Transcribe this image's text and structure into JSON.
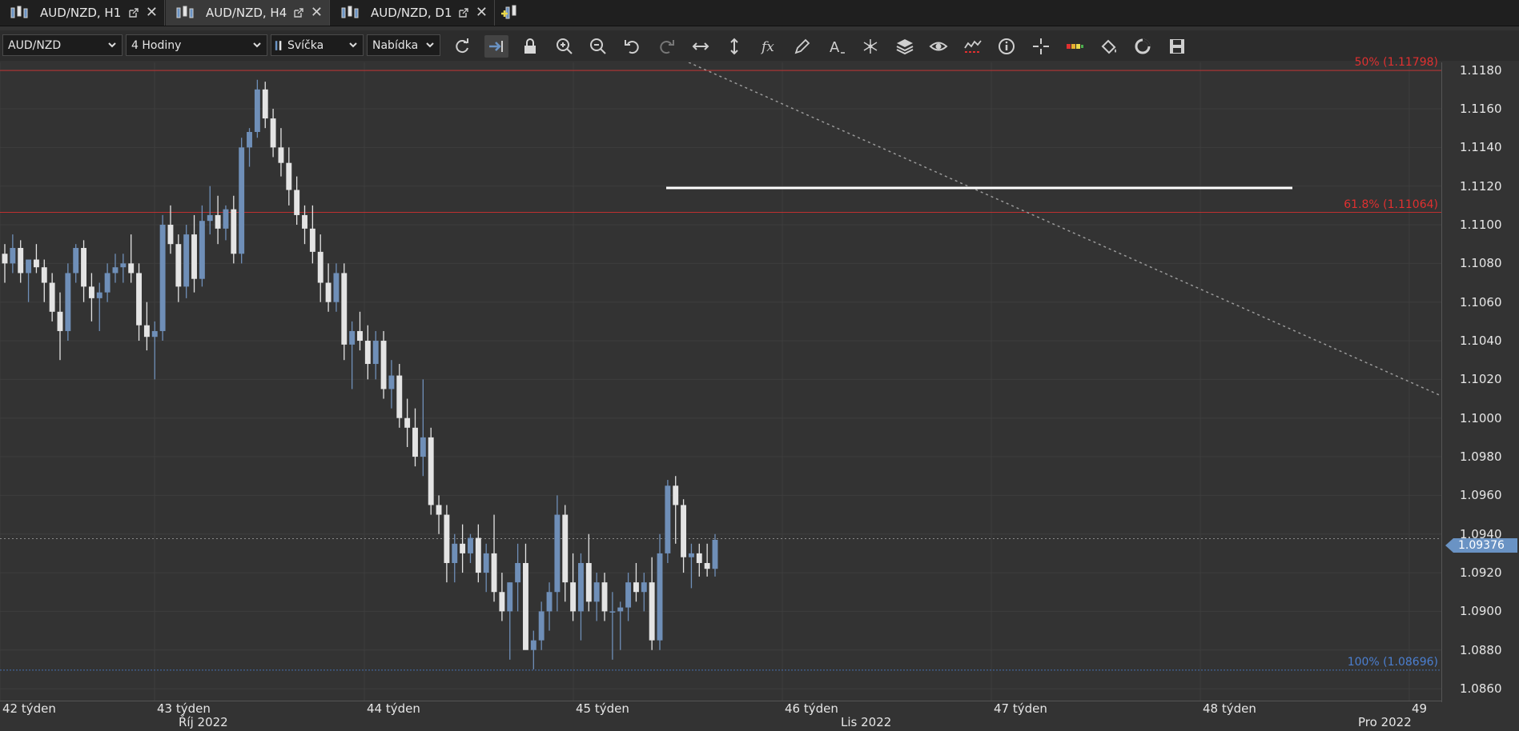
{
  "tabs": [
    {
      "label": "AUD/NZD, H1",
      "active": false
    },
    {
      "label": "AUD/NZD, H4",
      "active": true
    },
    {
      "label": "AUD/NZD, D1",
      "active": false
    }
  ],
  "toolbar": {
    "symbol": "AUD/NZD",
    "timeframe": "4 Hodiny",
    "chart_type": "Svíčka",
    "price_side": "Nabídka",
    "buttons": [
      "refresh-icon",
      "autoscroll-icon",
      "lock-icon",
      "zoom-in-icon",
      "zoom-out-icon",
      "undo-icon",
      "redo-icon",
      "horizontal-resize-icon",
      "vertical-resize-icon",
      "function-icon",
      "pencil-icon",
      "text-icon",
      "pattern-icon",
      "layers-icon",
      "eye-icon",
      "indicator-icon",
      "info-icon",
      "crosshair-icon",
      "heatmap-icon",
      "paint-bucket-icon",
      "template-icon",
      "save-icon"
    ]
  },
  "chart_data": {
    "type": "candlestick",
    "symbol": "AUD/NZD",
    "timeframe": "H4",
    "y_axis_ticks": [
      "1.1180",
      "1.1160",
      "1.1140",
      "1.1120",
      "1.1100",
      "1.1080",
      "1.1060",
      "1.1040",
      "1.1020",
      "1.1000",
      "1.0980",
      "1.0960",
      "1.0940",
      "1.0920",
      "1.0900",
      "1.0880",
      "1.0860"
    ],
    "ylim": [
      1.0853,
      1.1184
    ],
    "current_price": "1.09376",
    "week_labels": [
      "42 týden",
      "43 týden",
      "44 týden",
      "45 týden",
      "46 týden",
      "47 týden",
      "48 týden",
      "49"
    ],
    "month_labels": [
      "Říj 2022",
      "Lis 2022",
      "Pro 2022"
    ],
    "fib_levels": [
      {
        "label": "50% (1.11798)",
        "price": 1.11798,
        "color": "#e03030"
      },
      {
        "label": "61.8% (1.11064)",
        "price": 1.11064,
        "color": "#e03030"
      },
      {
        "label": "100% (1.08696)",
        "price": 1.08696,
        "color": "#4b7fd1"
      }
    ],
    "candles": [
      [
        1.1085,
        1.109,
        1.107,
        1.108
      ],
      [
        1.108,
        1.1095,
        1.1075,
        1.1088
      ],
      [
        1.1088,
        1.1092,
        1.107,
        1.1075
      ],
      [
        1.1075,
        1.108,
        1.106,
        1.1082
      ],
      [
        1.1082,
        1.109,
        1.1075,
        1.1078
      ],
      [
        1.1078,
        1.1082,
        1.106,
        1.107
      ],
      [
        1.107,
        1.1075,
        1.105,
        1.1055
      ],
      [
        1.1055,
        1.1065,
        1.103,
        1.1045
      ],
      [
        1.1045,
        1.108,
        1.104,
        1.1075
      ],
      [
        1.1075,
        1.109,
        1.107,
        1.1088
      ],
      [
        1.1088,
        1.1092,
        1.106,
        1.1068
      ],
      [
        1.1068,
        1.1075,
        1.105,
        1.1062
      ],
      [
        1.1062,
        1.107,
        1.1045,
        1.1065
      ],
      [
        1.1065,
        1.108,
        1.106,
        1.1075
      ],
      [
        1.1075,
        1.1085,
        1.107,
        1.1078
      ],
      [
        1.1078,
        1.1085,
        1.107,
        1.108
      ],
      [
        1.108,
        1.1095,
        1.107,
        1.1075
      ],
      [
        1.1075,
        1.108,
        1.104,
        1.1048
      ],
      [
        1.1048,
        1.106,
        1.1035,
        1.1042
      ],
      [
        1.1042,
        1.105,
        1.102,
        1.1045
      ],
      [
        1.1045,
        1.1105,
        1.104,
        1.11
      ],
      [
        1.11,
        1.111,
        1.1085,
        1.109
      ],
      [
        1.109,
        1.1095,
        1.106,
        1.1068
      ],
      [
        1.1068,
        1.11,
        1.1062,
        1.1095
      ],
      [
        1.1095,
        1.1105,
        1.1065,
        1.1072
      ],
      [
        1.1072,
        1.111,
        1.1068,
        1.1102
      ],
      [
        1.1102,
        1.112,
        1.1095,
        1.1105
      ],
      [
        1.1105,
        1.1115,
        1.109,
        1.1098
      ],
      [
        1.1098,
        1.111,
        1.1092,
        1.1108
      ],
      [
        1.1108,
        1.1115,
        1.108,
        1.1085
      ],
      [
        1.1085,
        1.1145,
        1.108,
        1.114
      ],
      [
        1.114,
        1.115,
        1.113,
        1.1148
      ],
      [
        1.1148,
        1.1175,
        1.1145,
        1.117
      ],
      [
        1.117,
        1.1174,
        1.115,
        1.1155
      ],
      [
        1.1155,
        1.116,
        1.1135,
        1.114
      ],
      [
        1.114,
        1.115,
        1.1125,
        1.1132
      ],
      [
        1.1132,
        1.114,
        1.111,
        1.1118
      ],
      [
        1.1118,
        1.1125,
        1.11,
        1.1105
      ],
      [
        1.1105,
        1.111,
        1.109,
        1.1098
      ],
      [
        1.1098,
        1.111,
        1.108,
        1.1086
      ],
      [
        1.1086,
        1.1095,
        1.106,
        1.107
      ],
      [
        1.107,
        1.108,
        1.1055,
        1.106
      ],
      [
        1.106,
        1.108,
        1.1055,
        1.1075
      ],
      [
        1.1075,
        1.108,
        1.103,
        1.1038
      ],
      [
        1.1038,
        1.105,
        1.1015,
        1.1045
      ],
      [
        1.1045,
        1.1055,
        1.1035,
        1.104
      ],
      [
        1.104,
        1.1048,
        1.102,
        1.1028
      ],
      [
        1.1028,
        1.1045,
        1.102,
        1.104
      ],
      [
        1.104,
        1.1045,
        1.101,
        1.1015
      ],
      [
        1.1015,
        1.103,
        1.1005,
        1.1022
      ],
      [
        1.1022,
        1.1028,
        1.0995,
        1.1
      ],
      [
        1.1,
        1.101,
        1.0985,
        1.0995
      ],
      [
        1.0995,
        1.1005,
        1.0975,
        1.098
      ],
      [
        1.098,
        1.102,
        1.097,
        1.099
      ],
      [
        1.099,
        1.0995,
        1.095,
        1.0955
      ],
      [
        1.0955,
        1.096,
        1.094,
        1.095
      ],
      [
        1.095,
        1.0955,
        1.0915,
        1.0925
      ],
      [
        1.0925,
        1.094,
        1.0915,
        1.0935
      ],
      [
        1.0935,
        1.0945,
        1.092,
        1.093
      ],
      [
        1.093,
        1.094,
        1.0925,
        1.0938
      ],
      [
        1.0938,
        1.0945,
        1.0915,
        1.092
      ],
      [
        1.092,
        1.0935,
        1.091,
        1.093
      ],
      [
        1.093,
        1.095,
        1.0905,
        1.091
      ],
      [
        1.091,
        1.092,
        1.0895,
        1.09
      ],
      [
        1.09,
        1.0915,
        1.0875,
        1.0915
      ],
      [
        1.0915,
        1.0935,
        1.09,
        1.0925
      ],
      [
        1.0925,
        1.0935,
        1.0895,
        1.088
      ],
      [
        1.088,
        1.089,
        1.087,
        1.0885
      ],
      [
        1.0885,
        1.0905,
        1.088,
        1.09
      ],
      [
        1.09,
        1.0915,
        1.089,
        1.091
      ],
      [
        1.091,
        1.096,
        1.09,
        1.095
      ],
      [
        1.095,
        1.0955,
        1.0905,
        1.0915
      ],
      [
        1.0915,
        1.093,
        1.0895,
        1.09
      ],
      [
        1.09,
        1.093,
        1.0885,
        1.0925
      ],
      [
        1.0925,
        1.094,
        1.09,
        1.0905
      ],
      [
        1.0905,
        1.092,
        1.0895,
        1.0915
      ],
      [
        1.0915,
        1.092,
        1.0895,
        1.09
      ],
      [
        1.09,
        1.091,
        1.0875,
        1.09
      ],
      [
        1.09,
        1.0905,
        1.088,
        1.0902
      ],
      [
        1.0902,
        1.092,
        1.0895,
        1.0915
      ],
      [
        1.0915,
        1.0925,
        1.0905,
        1.091
      ],
      [
        1.091,
        1.092,
        1.09,
        1.0915
      ],
      [
        1.0915,
        1.0928,
        1.088,
        1.0885
      ],
      [
        1.0885,
        1.094,
        1.088,
        1.093
      ],
      [
        1.093,
        1.0968,
        1.0925,
        1.0965
      ],
      [
        1.0965,
        1.097,
        1.0935,
        1.0955
      ],
      [
        1.0955,
        1.0958,
        1.092,
        1.0928
      ],
      [
        1.0928,
        1.0935,
        1.0912,
        1.093
      ],
      [
        1.093,
        1.0935,
        1.0918,
        1.0925
      ],
      [
        1.0925,
        1.0935,
        1.0918,
        1.0922
      ],
      [
        1.0922,
        1.094,
        1.0918,
        1.0937
      ]
    ]
  }
}
